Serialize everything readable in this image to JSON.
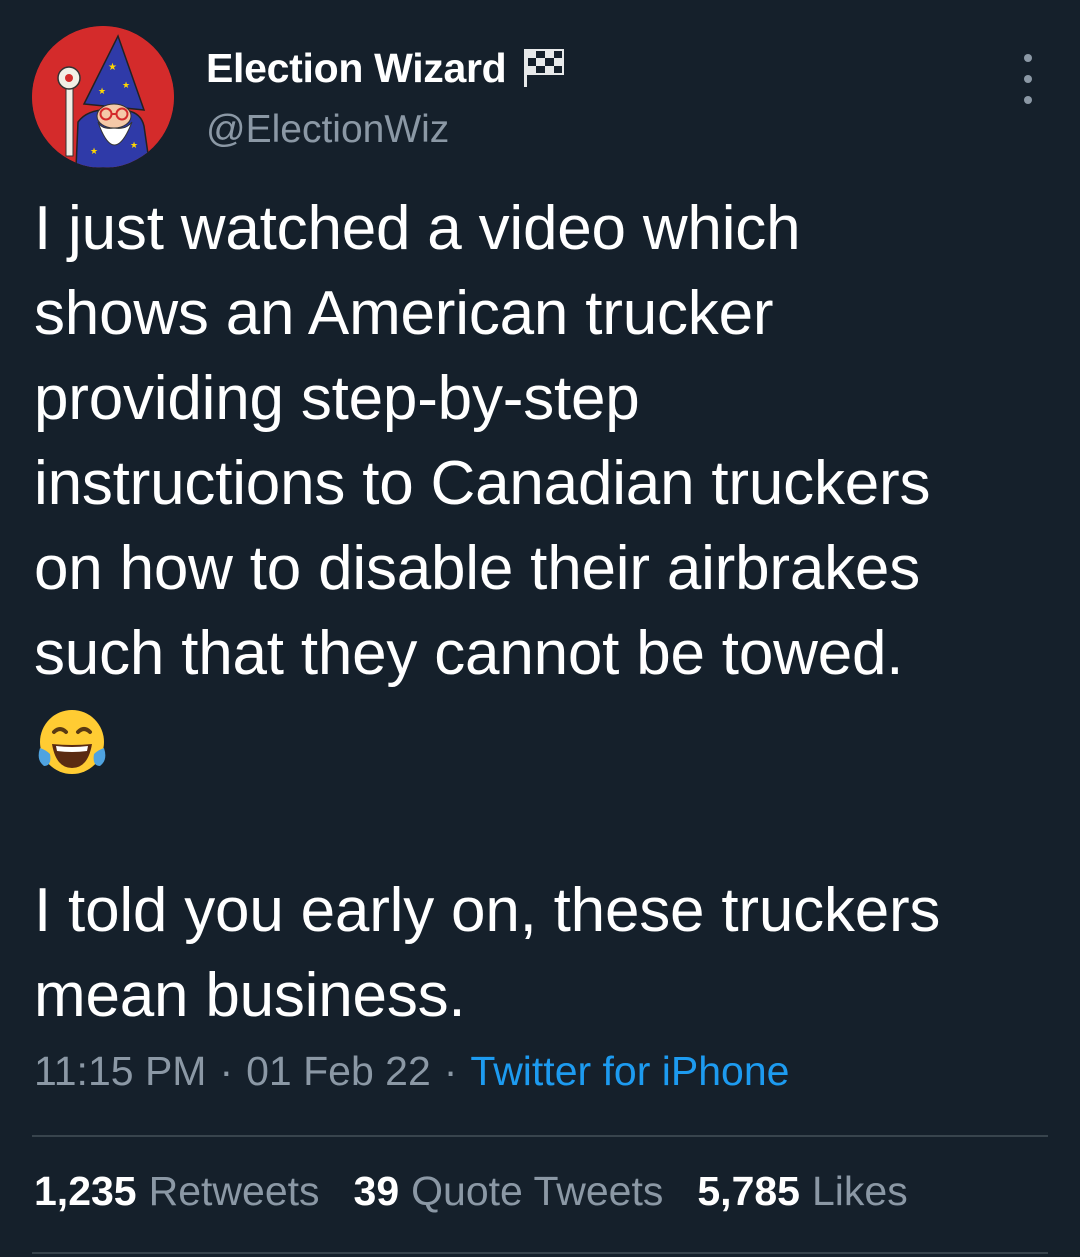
{
  "user": {
    "display_name": "Election Wizard",
    "handle": "@ElectionWiz",
    "flag_icon": "checkered-flag-icon",
    "avatar_icon": "wizard-avatar"
  },
  "tweet": {
    "text_part1": "I just watched a video which\nshows an American trucker\nproviding step-by-step\ninstructions to Canadian truckers\non how to disable their airbrakes\nsuch that they cannot be towed.",
    "emoji": "face-with-tears-of-joy-icon",
    "text_part2": "I told you early on, these truckers\nmean business.",
    "time": "11:15 PM",
    "separator": "·",
    "date": "01 Feb 22",
    "source": "Twitter for iPhone"
  },
  "stats": {
    "retweets_count": "1,235",
    "retweets_label": "Retweets",
    "quotes_count": "39",
    "quotes_label": "Quote Tweets",
    "likes_count": "5,785",
    "likes_label": "Likes"
  },
  "colors": {
    "background": "#15202b",
    "text": "#ffffff",
    "secondary": "#8b98a5",
    "link": "#1d9bf0",
    "divider": "#38444d",
    "avatar_bg": "#d42b2b"
  }
}
